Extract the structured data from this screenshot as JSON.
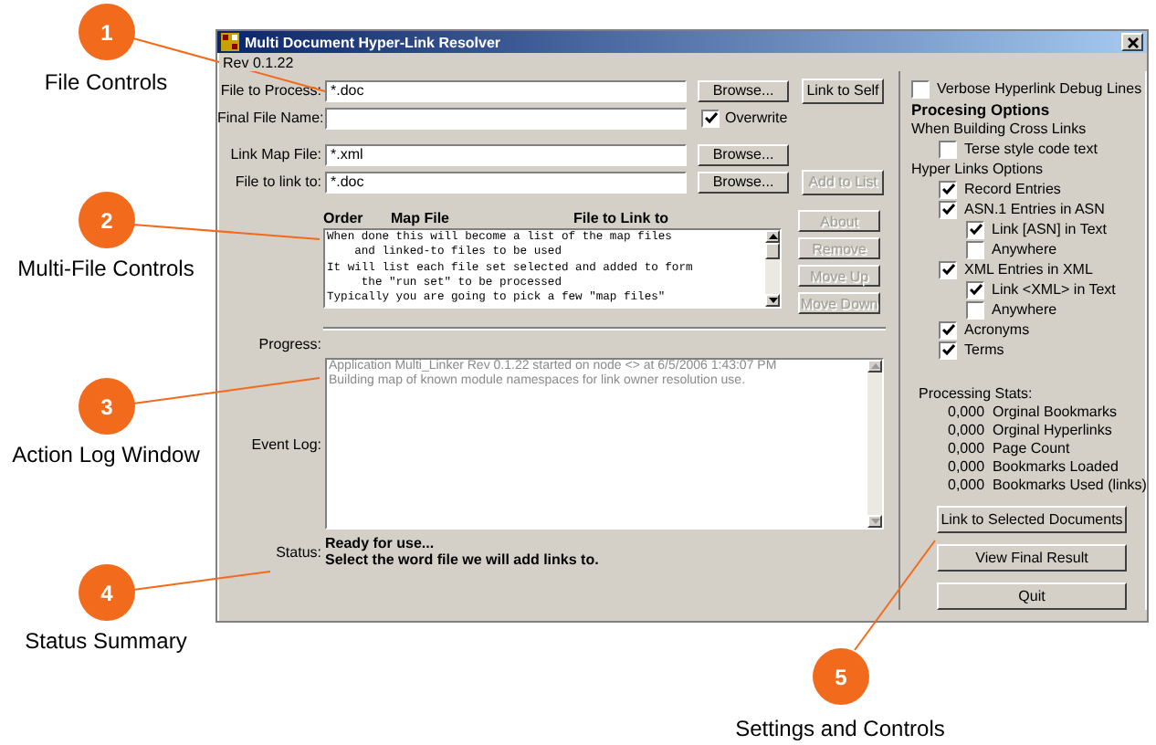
{
  "callouts": [
    {
      "number": "1",
      "label": "File Controls"
    },
    {
      "number": "2",
      "label": "Multi-File Controls"
    },
    {
      "number": "3",
      "label": "Action Log Window"
    },
    {
      "number": "4",
      "label": "Status Summary"
    },
    {
      "number": "5",
      "label": "Settings and Controls"
    }
  ],
  "window": {
    "title": "Multi Document Hyper-Link Resolver",
    "version": "Rev 0.1.22"
  },
  "file_fields": [
    {
      "label": "File to Process:",
      "value": "*.doc",
      "button": "Browse...",
      "extra": {
        "kind": "button",
        "label": "Link to Self",
        "disabled": false
      }
    },
    {
      "label": "Final File Name:",
      "extra": {
        "kind": "checkbox",
        "label": "Overwrite",
        "checked": true
      }
    },
    {
      "label": "Link Map File:",
      "value": "*.xml",
      "button": "Browse..."
    },
    {
      "label": "File to link to:",
      "value": "*.doc",
      "button": "Browse...",
      "extra": {
        "kind": "button",
        "label": "Add to List",
        "disabled": true
      }
    }
  ],
  "map_list": {
    "columns": [
      "Order",
      "Map File",
      "File to Link to"
    ],
    "lines": [
      "When done this will become a list of the map files",
      "    and linked-to files to be used",
      "It will list each file set selected and added to form",
      "     the \"run set\" to be processed",
      "Typically you are going to pick a few \"map files\""
    ],
    "buttons": [
      {
        "label": "About",
        "disabled": true
      },
      {
        "label": "Remove",
        "disabled": true
      },
      {
        "label": "Move Up",
        "disabled": true
      },
      {
        "label": "Move Down",
        "disabled": true
      }
    ]
  },
  "progress": {
    "label": "Progress:"
  },
  "event_log": {
    "label": "Event Log:",
    "lines": [
      "Application Multi_Linker Rev 0.1.22 started on node <> at 6/5/2006 1:43:07 PM",
      "Building map of known module namespaces for link owner resolution use."
    ]
  },
  "status": {
    "label": "Status:",
    "lines": [
      "Ready for use...",
      "Select the word file we will add links to."
    ]
  },
  "options": [
    {
      "kind": "checkbox",
      "label": "Verbose Hyperlink Debug Lines",
      "checked": false
    },
    {
      "kind": "heading",
      "label": "Procesing Options"
    },
    {
      "kind": "text",
      "label": "When Building Cross Links",
      "children": [
        {
          "kind": "checkbox",
          "label": "Terse style code text",
          "checked": false
        }
      ]
    },
    {
      "kind": "text",
      "label": "Hyper Links Options",
      "children": [
        {
          "kind": "checkbox",
          "label": "Record Entries",
          "checked": true
        },
        {
          "kind": "checkbox",
          "label": "ASN.1 Entries in ASN",
          "checked": true,
          "children": [
            {
              "kind": "checkbox",
              "label": "Link [ASN] in Text",
              "checked": true
            },
            {
              "kind": "checkbox",
              "label": "Anywhere",
              "checked": false
            }
          ]
        },
        {
          "kind": "checkbox",
          "label": "XML Entries in XML",
          "checked": true,
          "children": [
            {
              "kind": "checkbox",
              "label": "Link <XML> in Text",
              "checked": true
            },
            {
              "kind": "checkbox",
              "label": "Anywhere",
              "checked": false
            }
          ]
        },
        {
          "kind": "checkbox",
          "label": "Acronyms",
          "checked": true
        },
        {
          "kind": "checkbox",
          "label": "Terms",
          "checked": true
        }
      ]
    }
  ],
  "stats": {
    "title": "Processing Stats:",
    "rows": [
      "0,000  Orginal Bookmarks",
      "0,000  Orginal Hyperlinks",
      "0,000  Page Count",
      "0,000  Bookmarks Loaded",
      "0,000  Bookmarks Used (links)"
    ]
  },
  "actions": [
    "Link to Selected Documents",
    "View Final Result",
    "Quit"
  ]
}
